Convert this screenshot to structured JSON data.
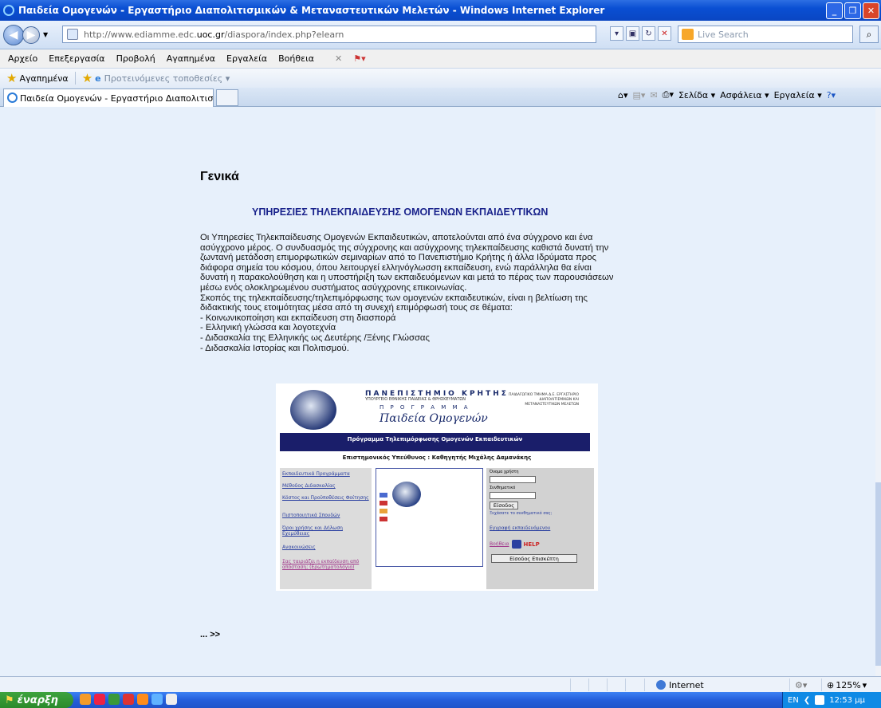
{
  "window": {
    "title": "Παιδεία Ομογενών - Εργαστήριο Διαπολιτισμικών & Μεταναστευτικών Μελετών - Windows Internet Explorer"
  },
  "address": {
    "prefix": "http://www.ediamme.edc.",
    "host": "uoc.gr",
    "path": "/diaspora/index.php?elearn",
    "search_placeholder": "Live Search"
  },
  "menu": [
    "Αρχείο",
    "Επεξεργασία",
    "Προβολή",
    "Αγαπημένα",
    "Εργαλεία",
    "Βοήθεια"
  ],
  "favbar": {
    "favorites": "Αγαπημένα",
    "suggested": "Προτεινόμενες τοποθεσίες ▾"
  },
  "tab": {
    "label": "Παιδεία Ομογενών - Εργαστήριο Διαπολιτισμικών & Με..."
  },
  "commandbar": {
    "page": "Σελίδα ▾",
    "safety": "Ασφάλεια ▾",
    "tools": "Εργαλεία ▾"
  },
  "page": {
    "heading": "Γενικά",
    "subheading": "ΥΠΗΡΕΣΙΕΣ ΤΗΛΕΚΠΑΙΔΕΥΣΗΣ ΟΜΟΓΕΝΩΝ ΕΚΠΑΙΔΕΥΤΙΚΩΝ",
    "lines": [
      "Οι Υπηρεσίες Τηλεκπαίδευσης Ομογενών Εκπαιδευτικών, αποτελούνται από ένα σύγχρονο και ένα",
      "ασύγχρονο μέρος. Ο συνδυασμός της σύγχρονης και ασύγχρονης τηλεκπαίδευσης καθιστά δυνατή την",
      "ζωντανή μετάδοση επιμορφωτικών σεμιναρίων από το Πανεπιστήμιο Κρήτης ή άλλα Ιδρύματα προς",
      "διάφορα σημεία του κόσμου, όπου λειτουργεί ελληνόγλωσση εκπαίδευση, ενώ παράλληλα θα είναι",
      "δυνατή η παρακολούθηση και η υποστήριξη των εκπαιδευόμενων και μετά το πέρας των παρουσιάσεων",
      "μέσω ενός ολοκληρωμένου συστήματος ασύγχρονης επικοινωνίας.",
      "Σκοπός της τηλεκπαίδευσης/τηλεπιμόρφωσης των ομογενών εκπαιδευτικών, είναι η βελτίωση της",
      "διδακτικής τους ετοιμότητας μέσα από τη συνεχή επιμόρφωσή τους σε θέματα:",
      "- Κοινωνικοποίηση και εκπαίδευση στη διασπορά",
      "- Ελληνική γλώσσα και λογοτεχνία",
      "- Διδασκαλία της Ελληνικής ως Δευτέρης /Ξένης Γλώσσας",
      "- Διδασκαλία Ιστορίας και Πολιτισμού."
    ],
    "more": "... >>"
  },
  "banner": {
    "univ": "ΠΑΝΕΠΙΣΤΗΜΙΟ ΚΡΗΤΗΣ",
    "ministry": "ΥΠΟΥΡΓΕΙΟ ΕΘΝΙΚΗΣ ΠΑΙΔΕΙΑΣ & ΘΡΗΣΚΕΥΜΑΤΩΝ",
    "program": "Π Ρ Ο Γ Ρ Α Μ Μ Α",
    "script": "Παιδεία Ομογενών",
    "dept": "ΠΑΙΔΑΓΩΓΙΚΟ ΤΜΗΜΑ Δ.Ε. ΕΡΓΑΣΤΗΡΙΟ ΔΙΑΠΟΛΙΤΙΣΜΙΚΩΝ ΚΑΙ ΜΕΤΑΝΑΣΤΕΥΤΙΚΩΝ ΜΕΛΕΤΩΝ",
    "strip": "Πρόγραμμα Τηλεπιμόρφωσης Ομογενών Εκπαιδευτικών",
    "supervisor": "Επιστημονικός Υπεύθυνος : Καθηγητής Μιχάλης Δαμανάκης",
    "menu": [
      "Εκπαιδευτικά Προγράμματα",
      "Μέθοδος Διδασκαλίας",
      "Κόστος και Προϋποθέσεις Φοίτησης",
      "Πιστοποιητικά Σπουδών",
      "Όροι χρήσης και Δήλωση Εχεμύθειας",
      "Ανακοινώσεις",
      "Σας ταιριάζει η εκπαίδευση από απόσταση; (Ερωτηματολόγιο)"
    ],
    "username": "Όνομα χρήστη",
    "password": "Συνθηματικό",
    "login": "Είσοδος",
    "forgot": "Ξεχάσατε το συνθηματικό σας;",
    "register": "Εγγραφή εκπαιδευόμενου",
    "help_label": "Βοήθεια",
    "help": "HELP",
    "guest": "Είσοδος Επισκέπτη"
  },
  "status": {
    "zone": "Internet",
    "zoom": "125%"
  },
  "taskbar": {
    "start": "έναρξη",
    "lang": "EN",
    "clock": "12:53 μμ"
  }
}
